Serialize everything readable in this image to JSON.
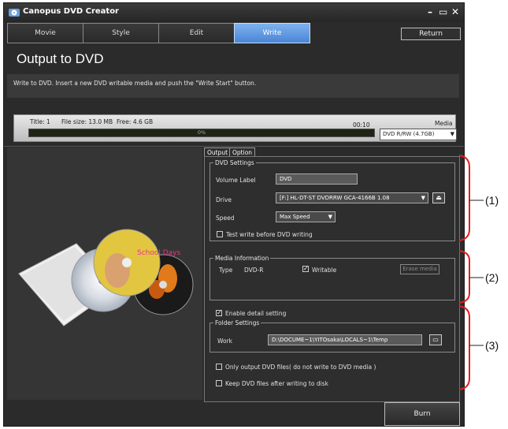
{
  "window": {
    "title": "Canopus DVD Creator",
    "controls": [
      "–",
      "▭",
      "✕"
    ]
  },
  "tabs": [
    {
      "label": "Movie",
      "active": false
    },
    {
      "label": "Style",
      "active": false
    },
    {
      "label": "Edit",
      "active": false
    },
    {
      "label": "Write",
      "active": true
    }
  ],
  "return_label": "Return",
  "page_title": "Output to DVD",
  "instruction": "Write to DVD. Insert a new DVD writable media and push the \"Write Start\" button.",
  "status": {
    "title": "Title: 1",
    "file_size": "File size: 13.0 MB",
    "free": "Free: 4.6 GB",
    "time": "00:10",
    "progress_label": "0%",
    "progress": 0,
    "media_label": "Media",
    "media_value": "DVD R/RW (4.7GB)"
  },
  "panel_tabs": {
    "output": "Output",
    "option": "Option"
  },
  "dvd_settings": {
    "legend": "DVD Settings",
    "volume_label": "Volume Label",
    "volume_value": "DVD",
    "drive_label": "Drive",
    "drive_value": "[F:] HL-DT-ST DVDRRW GCA-4166B 1.08",
    "speed_label": "Speed",
    "speed_value": "Max Speed",
    "test_write": {
      "label": "Test write before DVD writing",
      "checked": false
    }
  },
  "media_info": {
    "legend": "Media Information",
    "type_label": "Type",
    "type_value": "DVD-R",
    "writable": {
      "label": "Writable",
      "checked": true
    },
    "erase_label": "Erase media"
  },
  "detail": {
    "enable": {
      "label": "Enable detail setting",
      "checked": true
    },
    "folder_legend": "Folder Settings",
    "work_label": "Work",
    "work_value": "D:\\DOCUME~1\\YITOsaka\\LOCALS~1\\Temp",
    "only_output": {
      "label": "Only output DVD files( do not write to DVD media )",
      "checked": false
    },
    "keep_files": {
      "label": "Keep DVD files after writing to disk",
      "checked": false
    }
  },
  "burn_label": "Burn",
  "disc_label": "School Days",
  "callouts": [
    "(1)",
    "(2)",
    "(3)"
  ],
  "colors": {
    "active_tab": "#4a86d6",
    "callout_bracket": "#e02020",
    "window_bg": "#2b2b2b"
  }
}
